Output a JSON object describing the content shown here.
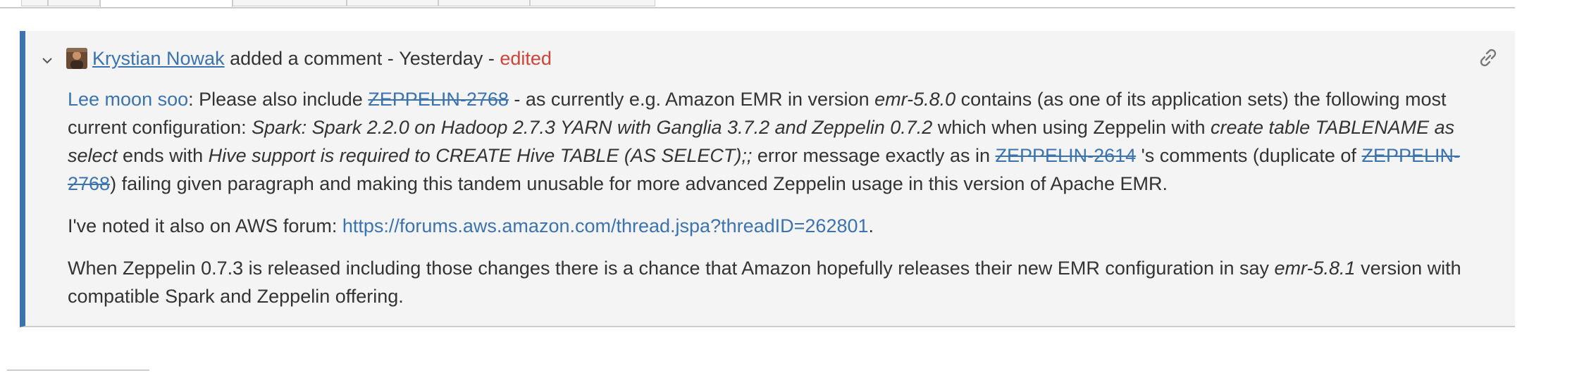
{
  "comment": {
    "author": "Krystian Nowak",
    "action": "added a comment",
    "separator": " - ",
    "when": "Yesterday",
    "edited": "edited",
    "icons": {
      "collapse": "chevron-down-icon",
      "permalink": "link-icon",
      "avatar": "user-avatar"
    },
    "p1": {
      "mention": "Lee moon soo",
      "t1": ": Please also include ",
      "issue1": "ZEPPELIN-2768",
      "t2": " - as currently e.g. Amazon EMR in version ",
      "i1": "emr-5.8.0",
      "t3": " contains (as one of its application sets) the following most current configuration: ",
      "i2": "Spark: Spark 2.2.0 on Hadoop 2.7.3 YARN with Ganglia 3.7.2 and Zeppelin 0.7.2",
      "t4": " which when using Zeppelin with ",
      "i3": "create table TABLENAME as select",
      "t5": " ends with ",
      "i4": "Hive support is required to CREATE Hive TABLE (AS SELECT);;",
      "t6": " error message exactly as in ",
      "issue2": "ZEPPELIN-2614",
      "t7": " 's comments (duplicate of ",
      "issue3": "ZEPPELIN-2768",
      "t8": ") failing given paragraph and making this tandem unusable for more advanced Zeppelin usage in this version of Apache EMR."
    },
    "p2": {
      "t1": "I've noted it also on AWS forum: ",
      "url": "https://forums.aws.amazon.com/thread.jspa?threadID=262801",
      "t2": "."
    },
    "p3": {
      "t1": "When Zeppelin 0.7.3 is released including those changes there is a chance that Amazon hopefully releases their new EMR configuration in say ",
      "i1": "emr-5.8.1",
      "t2": " version with compatible Spark and Zeppelin offering."
    }
  },
  "colors": {
    "accent": "#3b73af",
    "edited": "#d04437",
    "background": "#f4f4f4"
  }
}
